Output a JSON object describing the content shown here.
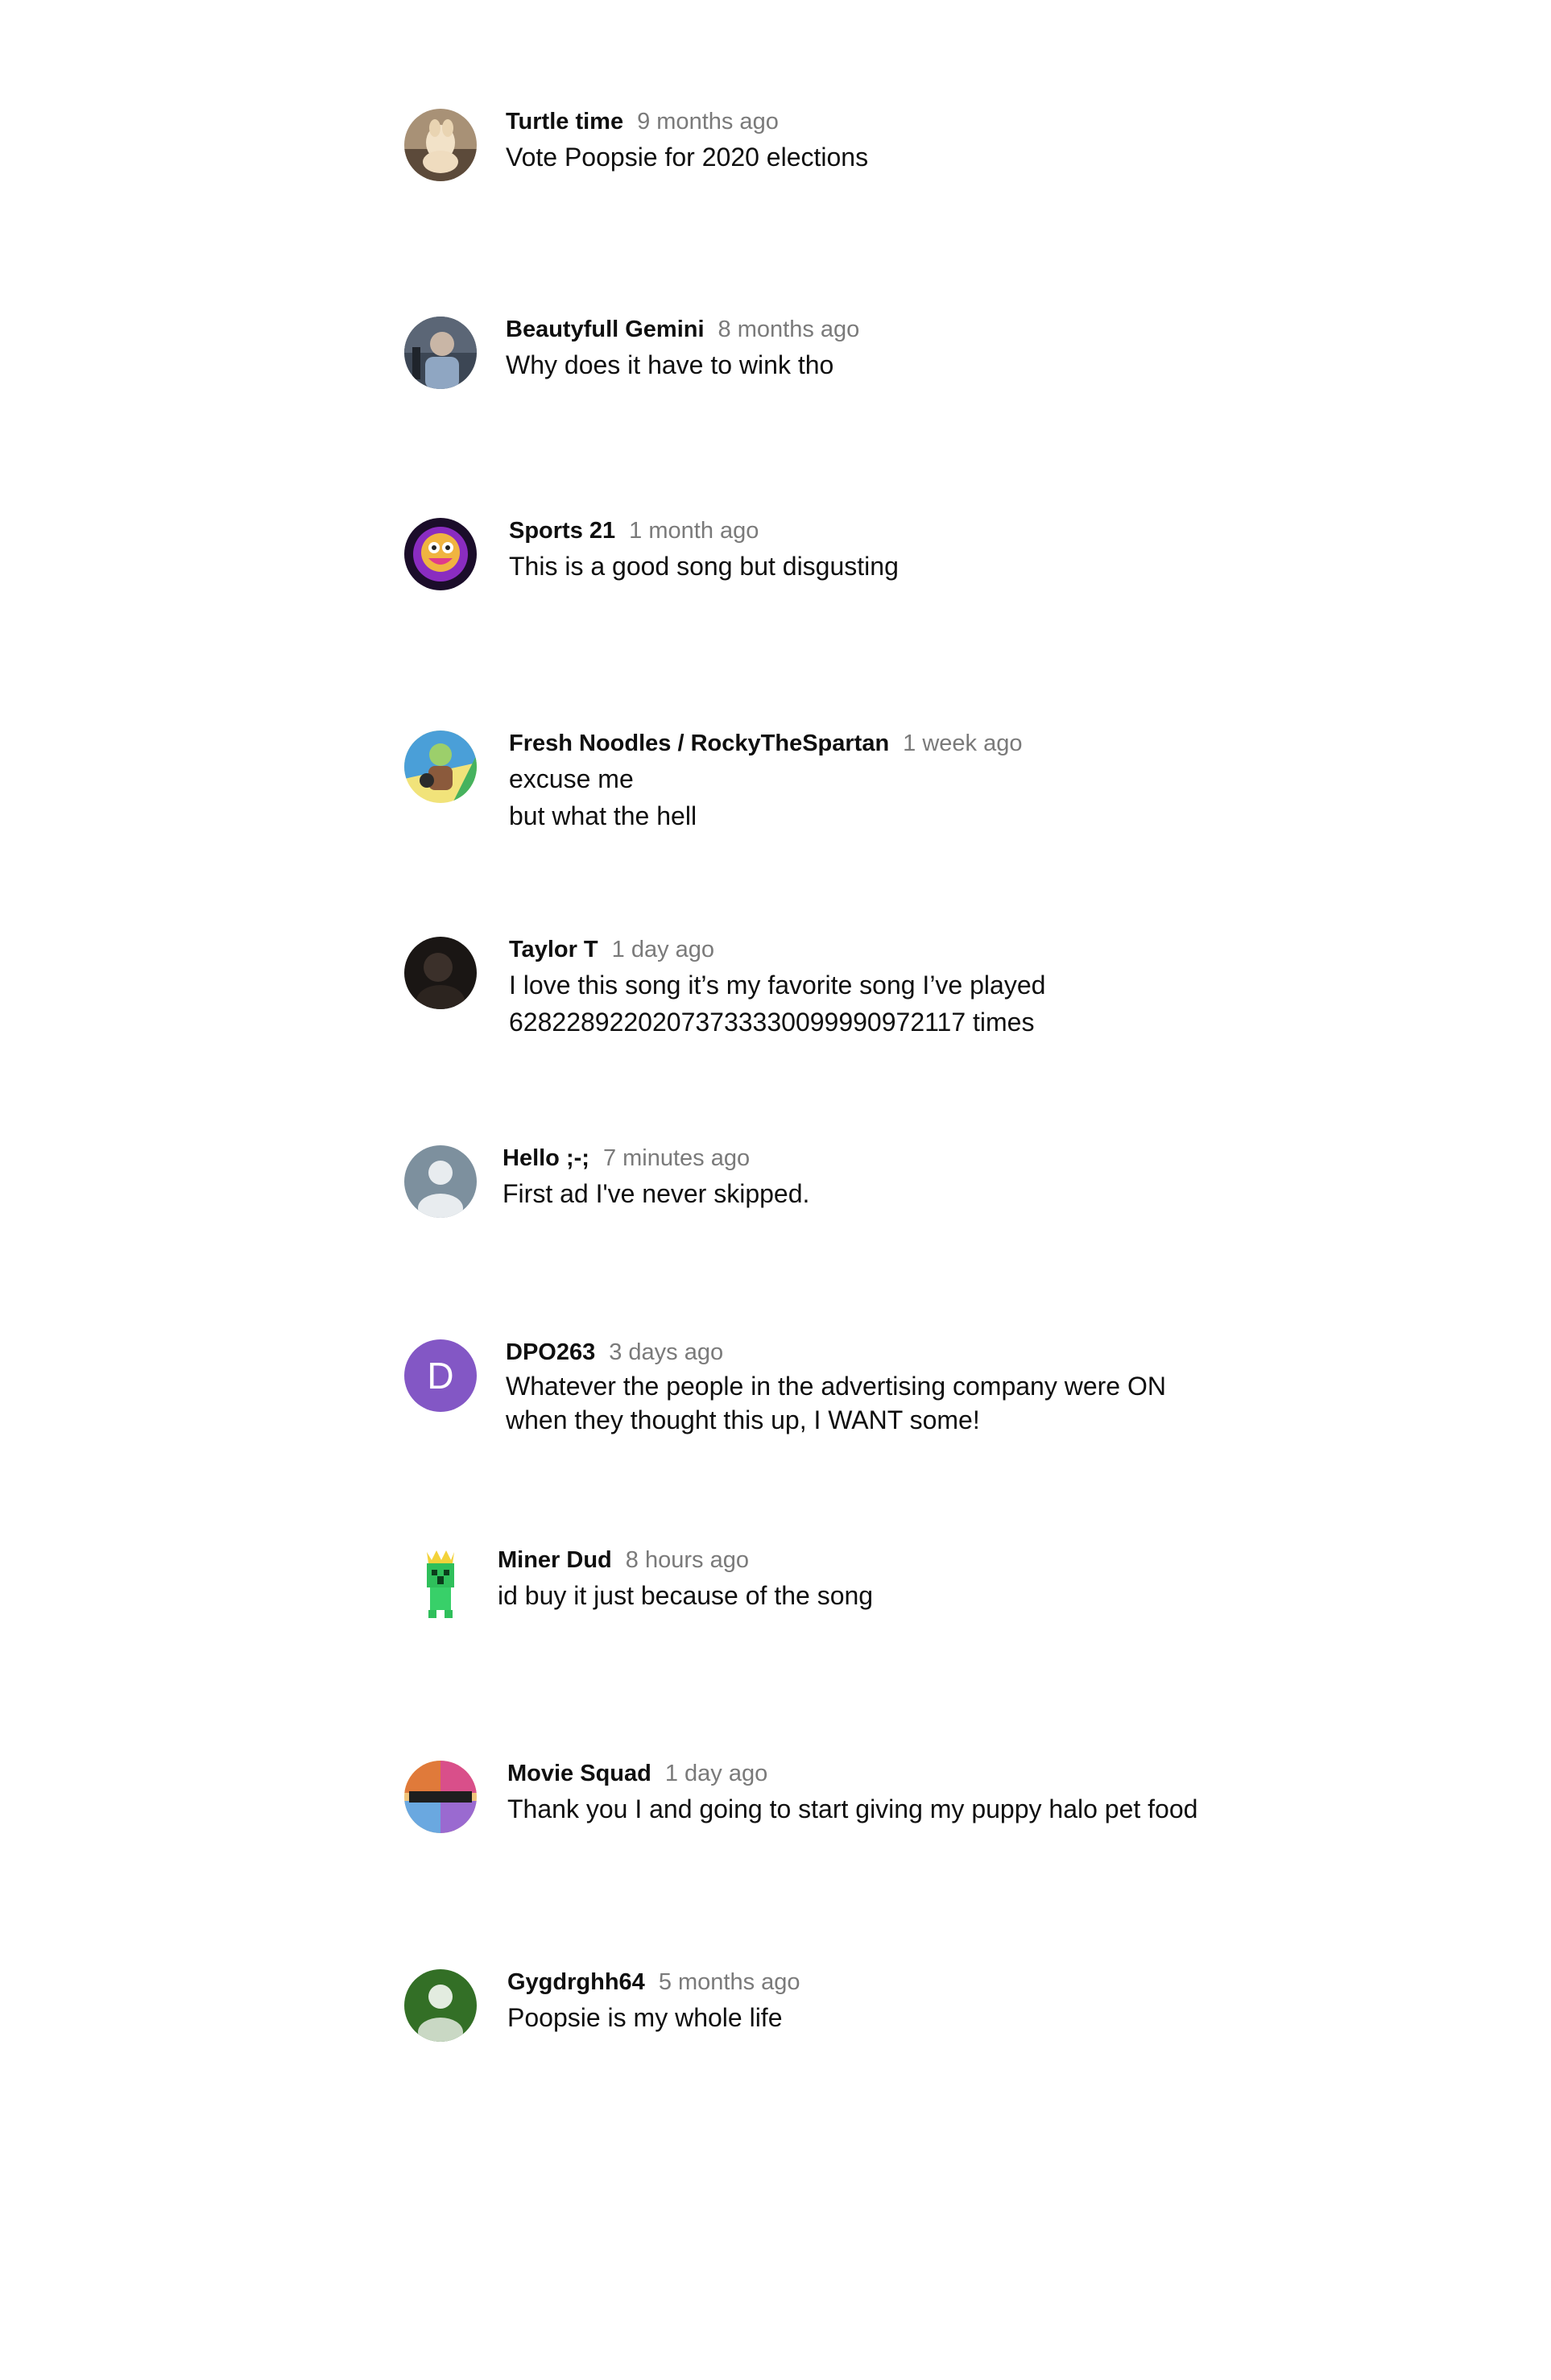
{
  "comments": [
    {
      "author": "Turtle time",
      "time": "9 months ago",
      "text": "Vote Poopsie for 2020 elections",
      "avatar_icon": "photo-avatar-dog",
      "avatar_color": "#8a7560"
    },
    {
      "author": "Beautyfull Gemini",
      "time": "8 months ago",
      "text": "Why does it have to wink tho",
      "avatar_icon": "photo-avatar-person",
      "avatar_color": "#6f7b8a"
    },
    {
      "author": "Sports 21",
      "time": "1 month ago",
      "text": "This is a good song but disgusting",
      "avatar_icon": "emoji-face-avatar",
      "avatar_color": "#7a2a9a"
    },
    {
      "author": "Fresh Noodles / RockyTheSpartan",
      "time": "1 week ago",
      "text": "excuse me\nbut what the hell",
      "avatar_icon": "cartoon-avatar",
      "avatar_color": "#5aa7d8"
    },
    {
      "author": "Taylor T",
      "time": "1 day ago",
      "text": "I love this song it’s my favorite song I’ve played\n62822892202073733330099990972117 times",
      "avatar_icon": "dark-photo-avatar",
      "avatar_color": "#2a2320"
    },
    {
      "author": "Hello ;-;",
      "time": "7 minutes ago",
      "text": "First ad I've never skipped.",
      "avatar_icon": "default-user-avatar",
      "avatar_color": "#7d909e"
    },
    {
      "author": "DPO263",
      "time": "3 days ago",
      "text": "Whatever the people in the advertising company were ON\n when they thought this up, I WANT some!",
      "avatar_icon": "letter-avatar",
      "avatar_letter": "D",
      "avatar_color": "#8357c5"
    },
    {
      "author": "Miner Dud",
      "time": "8 hours ago",
      "text": "id buy it just because of the song",
      "avatar_icon": "pixel-creeper-avatar",
      "avatar_color": "#2fbf5b"
    },
    {
      "author": "Movie Squad",
      "time": "1 day ago",
      "text": "Thank you I and going to start giving my puppy halo pet food",
      "avatar_icon": "collage-avatar",
      "avatar_color": "#e0a04a"
    },
    {
      "author": "Gygdrghh64",
      "time": "5 months ago",
      "text": "Poopsie is my whole life",
      "avatar_icon": "default-user-avatar",
      "avatar_color": "#336f26"
    }
  ]
}
